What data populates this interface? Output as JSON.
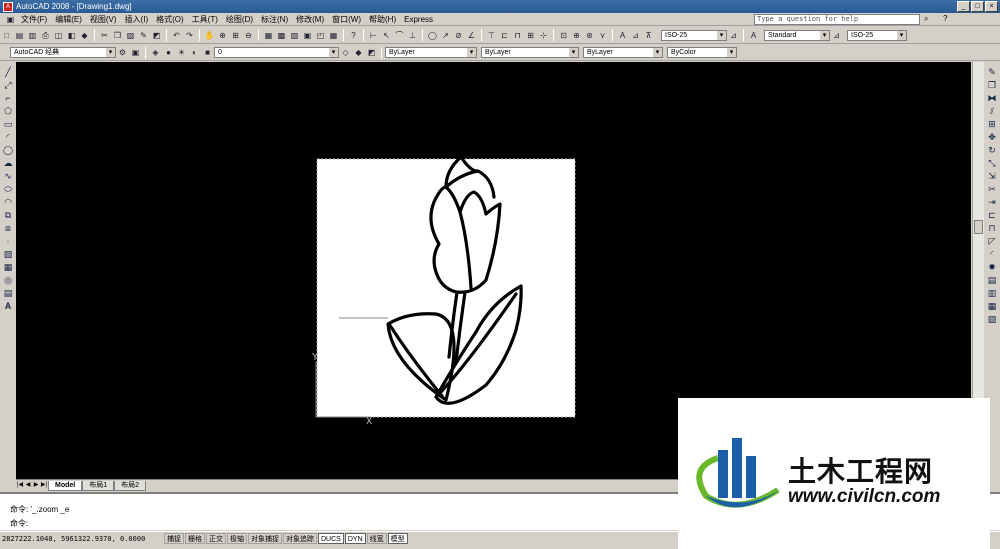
{
  "window": {
    "title": "AutoCAD 2008 - [Drawing1.dwg]",
    "controls": [
      "_",
      "□",
      "×"
    ]
  },
  "menu": {
    "items": [
      "文件(F)",
      "编辑(E)",
      "视图(V)",
      "插入(I)",
      "格式(O)",
      "工具(T)",
      "绘图(D)",
      "标注(N)",
      "修改(M)",
      "窗口(W)",
      "帮助(H)",
      "Express"
    ],
    "help_placeholder": "Type a question for help"
  },
  "toolbar1": {
    "dimstyle": "ISO-25",
    "textstyle": "Standard",
    "dimstyle2": "ISO-25"
  },
  "toolbar2": {
    "workspace": "AutoCAD 经典",
    "layer": "0",
    "color": "ByLayer",
    "linetype": "ByLayer",
    "lineweight": "ByLayer",
    "plotstyle": "ByColor"
  },
  "left_tools": [
    "line-icon",
    "xline-icon",
    "polyline-icon",
    "polygon-icon",
    "rectangle-icon",
    "arc-icon",
    "circle-icon",
    "cloud-icon",
    "spline-icon",
    "ellipse-icon",
    "ellipse-arc-icon",
    "insert-block-icon",
    "make-block-icon",
    "point-icon",
    "hatch-icon",
    "gradient-icon",
    "region-icon",
    "table-icon",
    "mtext-icon"
  ],
  "right_tools": [
    "erase-icon",
    "copy-icon",
    "mirror-icon",
    "offset-icon",
    "array-icon",
    "move-icon",
    "rotate-icon",
    "scale-icon",
    "stretch-icon",
    "trim-icon",
    "extend-icon",
    "break-icon",
    "join-icon",
    "chamfer-icon",
    "fillet-icon",
    "explode-icon"
  ],
  "tabs": [
    "Model",
    "布局1",
    "布局2"
  ],
  "command": {
    "line1": "命令: '_.zoom _e",
    "line2": "命令:"
  },
  "status": {
    "coords": "2827222.1048, 5961322.9370, 0.0000",
    "buttons": [
      {
        "label": "捕捉",
        "on": false
      },
      {
        "label": "栅格",
        "on": false
      },
      {
        "label": "正交",
        "on": false
      },
      {
        "label": "极轴",
        "on": false
      },
      {
        "label": "对象捕捉",
        "on": false
      },
      {
        "label": "对象追踪",
        "on": false
      },
      {
        "label": "DUCS",
        "on": true
      },
      {
        "label": "DYN",
        "on": true
      },
      {
        "label": "线宽",
        "on": false
      },
      {
        "label": "模型",
        "on": true
      }
    ]
  },
  "watermark": {
    "name": "土木工程网",
    "url": "www.civilcn.com",
    "colors": {
      "blue": "#1a5fa8",
      "green": "#6ab82c"
    }
  },
  "colors": {
    "titlebar": "#3a6ea5",
    "viewport": "#000000",
    "chrome": "#d4d0c8"
  }
}
